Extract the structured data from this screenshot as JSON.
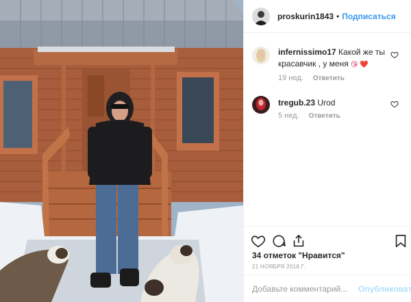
{
  "post": {
    "author": "proskurin1843",
    "separator": "•",
    "follow_label": "Подписаться"
  },
  "comments": [
    {
      "username": "infernissimo17",
      "text": "Какой же ты красавчик , у меня",
      "emoji": "😘 ❤️",
      "time": "19 нед.",
      "reply_label": "Ответить"
    },
    {
      "username": "tregub.23",
      "text": "Urod",
      "time": "5 нед.",
      "reply_label": "Ответить"
    }
  ],
  "actions": {
    "likes_text": "34 отметок \"Нравится\"",
    "date": "21 НОЯБРЯ 2018 Г."
  },
  "add_comment": {
    "placeholder": "Добавьте комментарий...",
    "post_label": "Опубликовать"
  },
  "colors": {
    "link": "#3897f0",
    "post_disabled": "#b2dffc",
    "muted": "#999999"
  },
  "icons": {
    "like": "heart-icon",
    "comment": "comment-icon",
    "share": "share-icon",
    "save": "bookmark-icon",
    "comment_like": "heart-icon"
  }
}
